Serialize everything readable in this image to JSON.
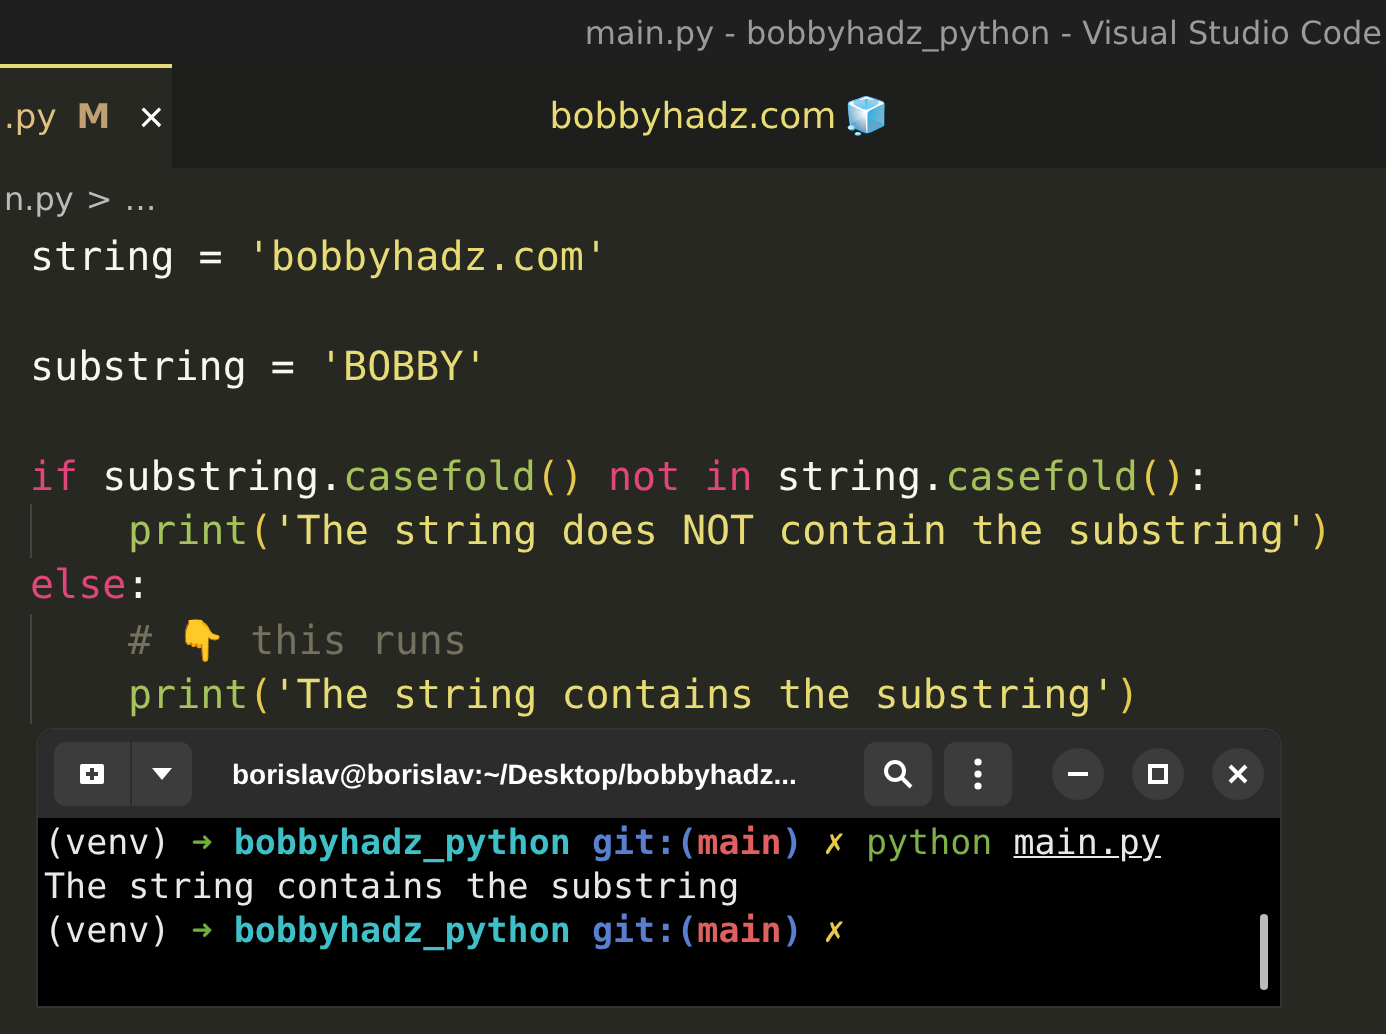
{
  "window": {
    "title": "main.py - bobbyhadz_python - Visual Studio Code"
  },
  "tabs": [
    {
      "label": ".py",
      "badge": "M",
      "close": "×",
      "selected": true
    }
  ],
  "banner": {
    "text": "bobbyhadz.com",
    "emoji": "🧊"
  },
  "breadcrumb": {
    "file": "n.py",
    "separator": ">",
    "rest": "…"
  },
  "code": [
    {
      "kind": "code",
      "tokens": [
        {
          "t": "string = ",
          "kind": "var"
        },
        {
          "t": "'bobbyhadz.com'",
          "kind": "str"
        }
      ]
    },
    {
      "kind": "blank"
    },
    {
      "kind": "code",
      "tokens": [
        {
          "t": "substring = ",
          "kind": "var"
        },
        {
          "t": "'BOBBY'",
          "kind": "str"
        }
      ]
    },
    {
      "kind": "blank"
    },
    {
      "kind": "code",
      "tokens": [
        {
          "t": "if",
          "kind": "kw"
        },
        {
          "t": " substring.",
          "kind": "var"
        },
        {
          "t": "casefold",
          "kind": "fn"
        },
        {
          "t": "()",
          "kind": "paren"
        },
        {
          "t": " not in",
          "kind": "kw"
        },
        {
          "t": " string.",
          "kind": "var"
        },
        {
          "t": "casefold",
          "kind": "fn"
        },
        {
          "t": "()",
          "kind": "paren"
        },
        {
          "t": ":",
          "kind": "var"
        }
      ],
      "children": [
        {
          "kind": "code",
          "tokens": [
            {
              "t": "print",
              "kind": "fn"
            },
            {
              "t": "(",
              "kind": "paren"
            },
            {
              "t": "'The string does NOT contain the substring'",
              "kind": "str"
            },
            {
              "t": ")",
              "kind": "paren"
            }
          ]
        }
      ]
    },
    {
      "kind": "code",
      "tokens": [
        {
          "t": "else",
          "kind": "kw"
        },
        {
          "t": ":",
          "kind": "var"
        }
      ],
      "children": [
        {
          "kind": "code",
          "tokens": [
            {
              "t": "# 👇 this runs",
              "kind": "comment"
            }
          ]
        },
        {
          "kind": "code",
          "tokens": [
            {
              "t": "print",
              "kind": "fn"
            },
            {
              "t": "(",
              "kind": "paren"
            },
            {
              "t": "'The string contains the substring'",
              "kind": "str"
            },
            {
              "t": ")",
              "kind": "paren"
            }
          ]
        }
      ]
    }
  ],
  "terminal": {
    "title": "borislav@borislav:~/Desktop/bobbyhadz...",
    "lines": [
      [
        {
          "t": "(venv) ",
          "kind": "plain"
        },
        {
          "t": "➜ ",
          "kind": "arrow"
        },
        {
          "t": "bobbyhadz_python ",
          "kind": "dir"
        },
        {
          "t": "git:(",
          "kind": "git"
        },
        {
          "t": "main",
          "kind": "branch"
        },
        {
          "t": ") ",
          "kind": "git"
        },
        {
          "t": "✗ ",
          "kind": "dirty"
        },
        {
          "t": "python ",
          "kind": "cmd"
        },
        {
          "t": "main.py",
          "kind": "file"
        }
      ],
      [
        {
          "t": "The string contains the substring",
          "kind": "plain"
        }
      ],
      [
        {
          "t": "(venv) ",
          "kind": "plain"
        },
        {
          "t": "➜ ",
          "kind": "arrow"
        },
        {
          "t": "bobbyhadz_python ",
          "kind": "dir"
        },
        {
          "t": "git:(",
          "kind": "git"
        },
        {
          "t": "main",
          "kind": "branch"
        },
        {
          "t": ") ",
          "kind": "git"
        },
        {
          "t": "✗",
          "kind": "dirty"
        }
      ]
    ]
  }
}
